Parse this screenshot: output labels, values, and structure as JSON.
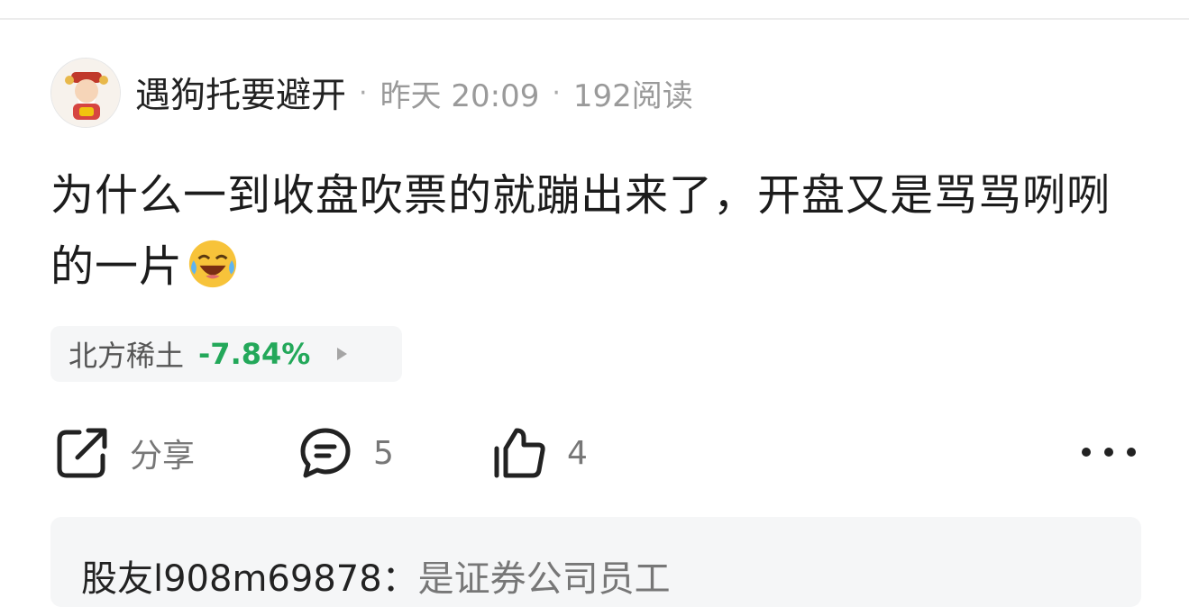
{
  "post": {
    "author": "遇狗托要避开",
    "separator": "·",
    "time": "昨天 20:09",
    "reads": "192阅读",
    "text": "为什么一到收盘吹票的就蹦出来了，开盘又是骂骂咧咧的一片",
    "emoji": "face-with-tears-of-joy-emoji"
  },
  "stock": {
    "name": "北方稀土",
    "change": "-7.84%",
    "change_color": "#23a85a"
  },
  "actions": {
    "share_label": "分享",
    "comment_count": "5",
    "like_count": "4"
  },
  "reply": {
    "user": "股友l908m69878：",
    "text": "是证券公司员工"
  }
}
